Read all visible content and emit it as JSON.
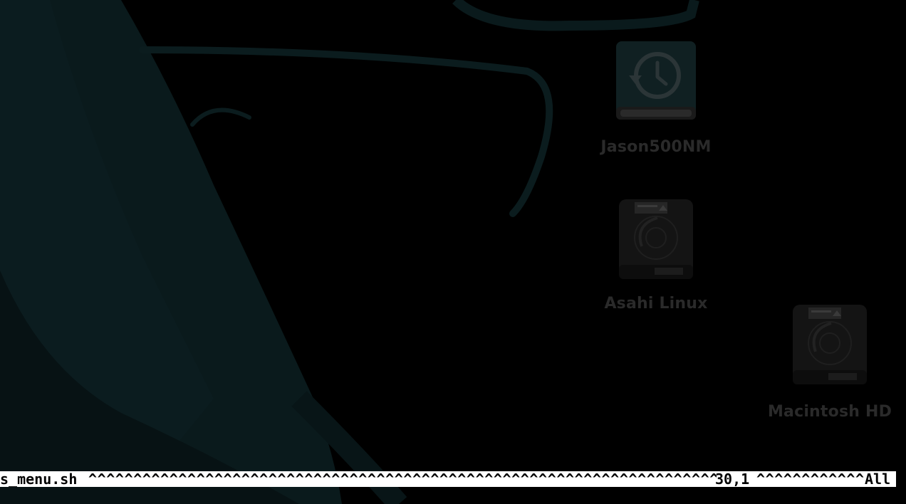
{
  "desktop": {
    "disks": [
      {
        "label": "Jason500NM",
        "icon": "time-machine-disk-icon"
      },
      {
        "label": "Asahi Linux",
        "icon": "hard-disk-icon"
      },
      {
        "label": "Macintosh HD",
        "icon": "hard-disk-icon"
      }
    ]
  },
  "vim_status": {
    "filename": "s_menu.sh",
    "fill_left": "^^^^^^^^^^^^^^^^^^^^^^^^^^^^^^^^^^^^^^^^^^^^^^^^^^^^^^^^^^^^^^^^^^^^^^^^^^^^^^",
    "position": "30,1",
    "fill_right": "^^^^^^^^^^^^^",
    "scroll": "All"
  },
  "colors": {
    "background": "#000000",
    "wallpaper_shape": "#0a1a1c",
    "label": "#2a2a2a",
    "status_bar": "#ffffff"
  }
}
